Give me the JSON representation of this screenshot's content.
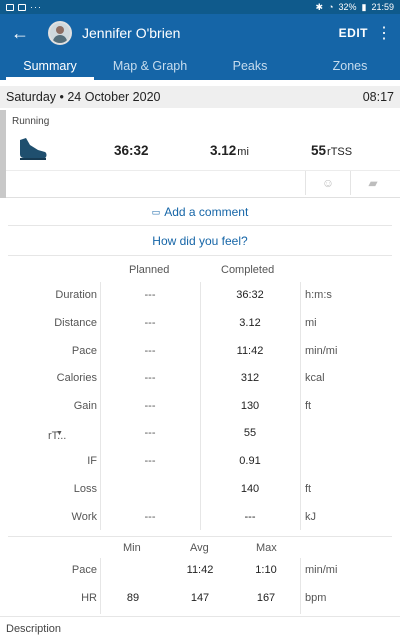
{
  "status_bar": {
    "battery": "32%",
    "time": "21:59"
  },
  "header": {
    "athlete_name": "Jennifer O'brien",
    "edit_label": "EDIT"
  },
  "tabs": [
    {
      "label": "Summary"
    },
    {
      "label": "Map & Graph"
    },
    {
      "label": "Peaks"
    },
    {
      "label": "Zones"
    }
  ],
  "workout": {
    "date": "Saturday • 24 October 2020",
    "time": "08:17",
    "sport": "Running",
    "duration": "36:32",
    "distance": "3.12",
    "distance_unit": "mi",
    "tss": "55",
    "tss_unit": "rTSS"
  },
  "links": {
    "add_comment": "Add a comment",
    "how_did_you_feel": "How did you feel?"
  },
  "stats": {
    "headers": {
      "planned": "Planned",
      "completed": "Completed"
    },
    "rows": [
      {
        "label": "Duration",
        "planned": "---",
        "completed": "36:32",
        "unit": "h:m:s"
      },
      {
        "label": "Distance",
        "planned": "---",
        "completed": "3.12",
        "unit": "mi"
      },
      {
        "label": "Pace",
        "planned": "---",
        "completed": "11:42",
        "unit": "min/mi"
      },
      {
        "label": "Calories",
        "planned": "---",
        "completed": "312",
        "unit": "kcal"
      },
      {
        "label": "Gain",
        "planned": "---",
        "completed": "130",
        "unit": "ft"
      },
      {
        "label": "rT...",
        "planned": "---",
        "completed": "55",
        "unit": ""
      },
      {
        "label": "IF",
        "planned": "---",
        "completed": "0.91",
        "unit": ""
      },
      {
        "label": "Loss",
        "planned": "",
        "completed": "140",
        "unit": "ft"
      },
      {
        "label": "Work",
        "planned": "---",
        "completed": "---",
        "unit": "kJ"
      }
    ]
  },
  "ranges": {
    "headers": {
      "min": "Min",
      "avg": "Avg",
      "max": "Max"
    },
    "rows": [
      {
        "label": "Pace",
        "min": "",
        "avg": "11:42",
        "max": "1:10",
        "unit": "min/mi"
      },
      {
        "label": "HR",
        "min": "89",
        "avg": "147",
        "max": "167",
        "unit": "bpm"
      }
    ]
  },
  "description_label": "Description",
  "colors": {
    "primary": "#1565a7",
    "statusbar": "#0f5a8c",
    "link": "#1565a7"
  }
}
